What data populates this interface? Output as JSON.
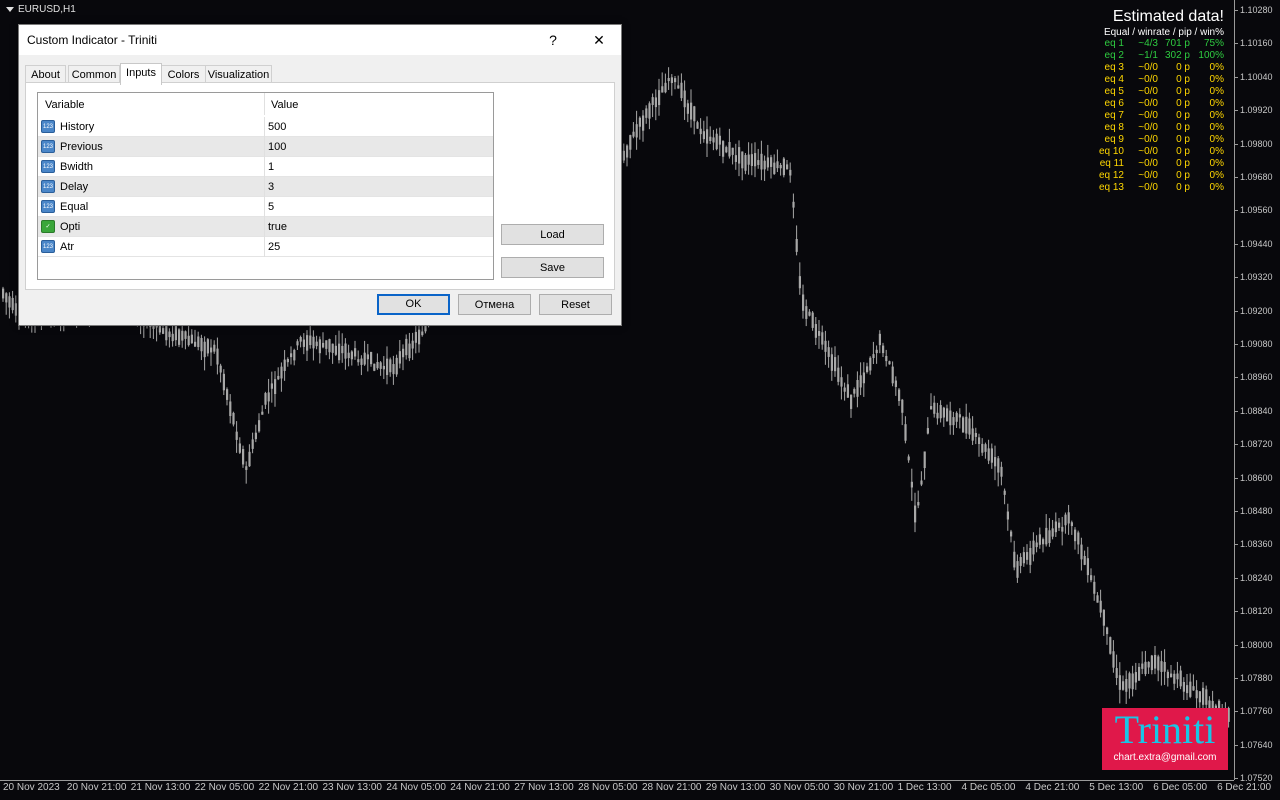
{
  "chart": {
    "symbol": "EURUSD,H1",
    "price_ticks": [
      "1.10280",
      "1.10160",
      "1.10040",
      "1.09920",
      "1.09800",
      "1.09680",
      "1.09560",
      "1.09440",
      "1.09320",
      "1.09200",
      "1.09080",
      "1.08960",
      "1.08840",
      "1.08720",
      "1.08600",
      "1.08480",
      "1.08360",
      "1.08240",
      "1.08120",
      "1.08000",
      "1.07880",
      "1.07760",
      "1.07640",
      "1.07520"
    ],
    "time_ticks": [
      "20 Nov 2023",
      "20 Nov 21:00",
      "21 Nov 13:00",
      "22 Nov 05:00",
      "22 Nov 21:00",
      "23 Nov 13:00",
      "24 Nov 05:00",
      "24 Nov 21:00",
      "27 Nov 13:00",
      "28 Nov 05:00",
      "28 Nov 21:00",
      "29 Nov 13:00",
      "30 Nov 05:00",
      "30 Nov 21:00",
      "1 Dec 13:00",
      "4 Dec 05:00",
      "4 Dec 21:00",
      "5 Dec 13:00",
      "6 Dec 05:00",
      "6 Dec 21:00"
    ],
    "candle_color": "#a8a8a8",
    "background": "#08080c"
  },
  "estimated": {
    "title": "Estimated data!",
    "header": "Equal / winrate / pip / win%",
    "rows": [
      {
        "eq": "eq 1",
        "rate": "~4/3",
        "pip": "701 p",
        "win": "75%",
        "color": "#2ecc40"
      },
      {
        "eq": "eq 2",
        "rate": "~1/1",
        "pip": "302 p",
        "win": "100%",
        "color": "#2ecc40"
      },
      {
        "eq": "eq 3",
        "rate": "~0/0",
        "pip": "0 p",
        "win": "0%",
        "color": "#ffd700"
      },
      {
        "eq": "eq 4",
        "rate": "~0/0",
        "pip": "0 p",
        "win": "0%",
        "color": "#ffd700"
      },
      {
        "eq": "eq 5",
        "rate": "~0/0",
        "pip": "0 p",
        "win": "0%",
        "color": "#ffd700"
      },
      {
        "eq": "eq 6",
        "rate": "~0/0",
        "pip": "0 p",
        "win": "0%",
        "color": "#ffd700"
      },
      {
        "eq": "eq 7",
        "rate": "~0/0",
        "pip": "0 p",
        "win": "0%",
        "color": "#ffd700"
      },
      {
        "eq": "eq 8",
        "rate": "~0/0",
        "pip": "0 p",
        "win": "0%",
        "color": "#ffd700"
      },
      {
        "eq": "eq 9",
        "rate": "~0/0",
        "pip": "0 p",
        "win": "0%",
        "color": "#ffd700"
      },
      {
        "eq": "eq 10",
        "rate": "~0/0",
        "pip": "0 p",
        "win": "0%",
        "color": "#ffd700"
      },
      {
        "eq": "eq 11",
        "rate": "~0/0",
        "pip": "0 p",
        "win": "0%",
        "color": "#ffd700"
      },
      {
        "eq": "eq 12",
        "rate": "~0/0",
        "pip": "0 p",
        "win": "0%",
        "color": "#ffd700"
      },
      {
        "eq": "eq 13",
        "rate": "~0/0",
        "pip": "0 p",
        "win": "0%",
        "color": "#ffd700"
      }
    ]
  },
  "logo": {
    "name": "Triniti",
    "email": "chart.extra@gmail.com"
  },
  "dialog": {
    "title": "Custom Indicator - Triniti",
    "help": "?",
    "close": "✕",
    "tabs": [
      "About",
      "Common",
      "Inputs",
      "Colors",
      "Visualization"
    ],
    "active_tab": "Inputs",
    "table_headers": {
      "variable": "Variable",
      "value": "Value"
    },
    "params": [
      {
        "name": "History",
        "value": "500",
        "type": "int",
        "icon": "123"
      },
      {
        "name": "Previous",
        "value": "100",
        "type": "int",
        "icon": "123"
      },
      {
        "name": "Bwidth",
        "value": "1",
        "type": "int",
        "icon": "123"
      },
      {
        "name": "Delay",
        "value": "3",
        "type": "int",
        "icon": "123"
      },
      {
        "name": "Equal",
        "value": "5",
        "type": "int",
        "icon": "123"
      },
      {
        "name": "Opti",
        "value": "true",
        "type": "bool",
        "icon": "✓"
      },
      {
        "name": "Atr",
        "value": "25",
        "type": "int",
        "icon": "123"
      }
    ],
    "load": "Load",
    "save": "Save",
    "ok": "OK",
    "cancel": "Отмена",
    "reset": "Reset"
  }
}
